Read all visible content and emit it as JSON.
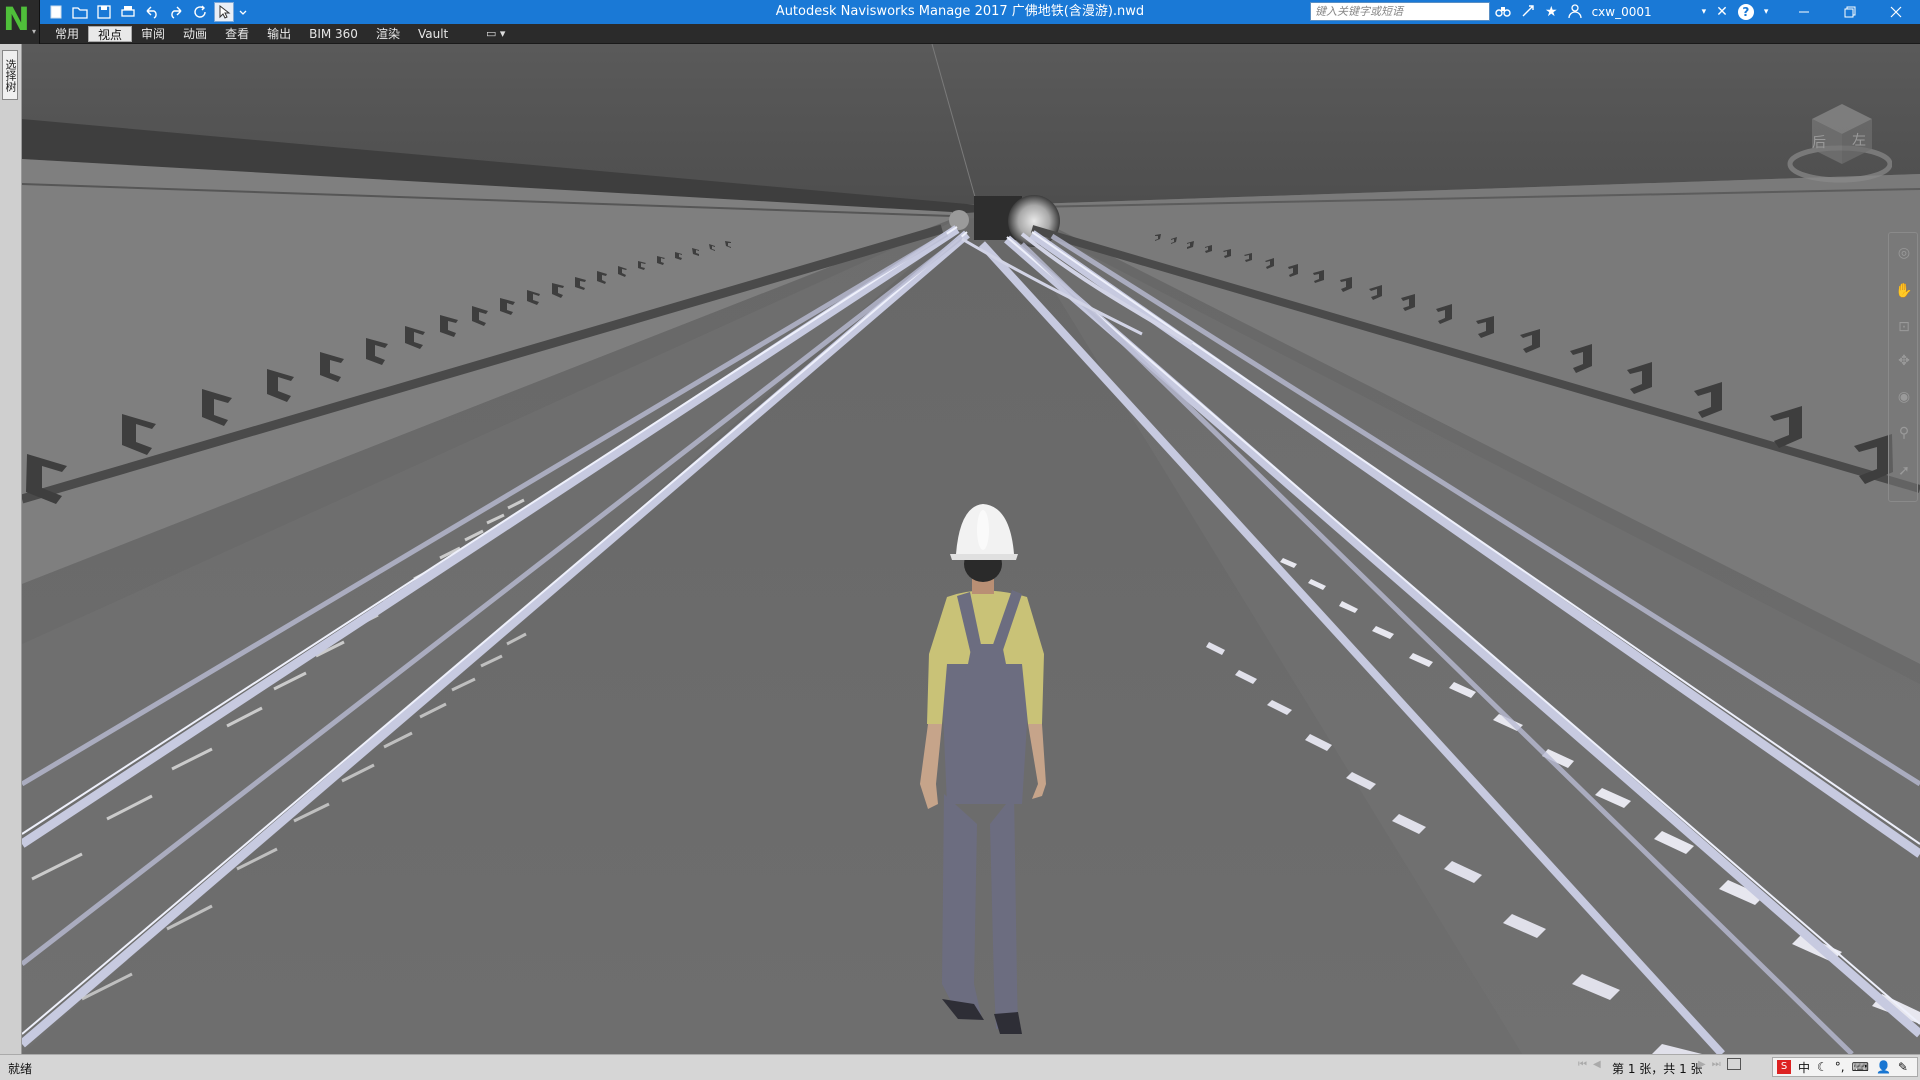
{
  "window": {
    "title": "Autodesk Navisworks Manage 2017    广佛地铁(含漫游).nwd",
    "app_letter": "N"
  },
  "quick_access": {
    "icons": [
      "new-icon",
      "open-icon",
      "save-icon",
      "print-icon",
      "undo-icon",
      "redo-icon",
      "refresh-icon",
      "select-icon",
      "customize-icon"
    ]
  },
  "search": {
    "placeholder": "键入关键字或短语"
  },
  "user": {
    "name": "cxw_0001"
  },
  "ribbon": {
    "tabs": [
      {
        "label": "常用",
        "active": false
      },
      {
        "label": "视点",
        "active": true
      },
      {
        "label": "审阅",
        "active": false
      },
      {
        "label": "动画",
        "active": false
      },
      {
        "label": "查看",
        "active": false
      },
      {
        "label": "输出",
        "active": false
      },
      {
        "label": "BIM 360",
        "active": false
      },
      {
        "label": "渲染",
        "active": false
      },
      {
        "label": "Vault",
        "active": false
      }
    ],
    "extra": "▭ ▾"
  },
  "left_panel": {
    "selection_tree_label": "选择树"
  },
  "viewcube": {
    "face_label": "后",
    "side_label": "左"
  },
  "navbar": {
    "tools": [
      "steering-wheel-icon",
      "pan-icon",
      "zoom-icon",
      "orbit-icon",
      "look-icon",
      "walk-icon",
      "select-icon"
    ]
  },
  "statusbar": {
    "status": "就绪",
    "sheet_info": "第 1 张，共 1 张",
    "ime_lang": "中"
  },
  "colors": {
    "titlebar": "#1a79d6",
    "viewport_bg": "#6b6b6b",
    "ceiling": "#555555",
    "wall": "#7e7e7e",
    "rail": "#c8cbe0",
    "worker_shirt": "#c9c277",
    "worker_overalls": "#6c6d80",
    "helmet": "#f2f2f2"
  }
}
